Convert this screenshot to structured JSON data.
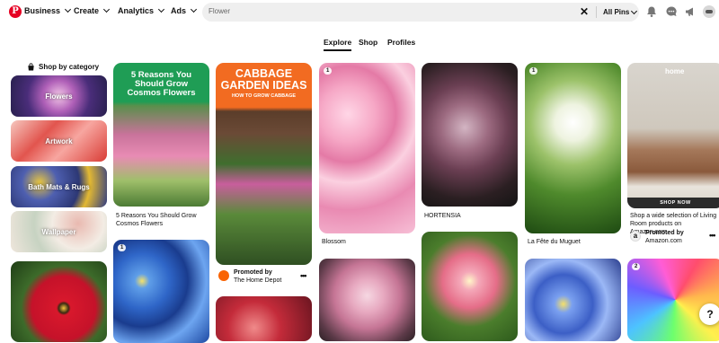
{
  "header": {
    "logo": "P",
    "nav": [
      "Business",
      "Create",
      "Analytics",
      "Ads"
    ],
    "search_value": "Flower",
    "search_clear": "✕",
    "filter_label": "All Pins",
    "icons": [
      "bell-icon",
      "messages-icon",
      "megaphone-icon",
      "account-avatar"
    ]
  },
  "tabs": [
    "Explore",
    "Shop",
    "Profiles"
  ],
  "categories": {
    "heading": "Shop by category",
    "items": [
      "Flowers",
      "Artwork",
      "Bath Mats & Rugs",
      "Wallpaper"
    ]
  },
  "pins": {
    "cosmos": {
      "title_line1": "5 Reasons You",
      "title_line2": "Should Grow",
      "title_line3": "Cosmos Flowers",
      "caption_line1": "5 Reasons You Should Grow",
      "caption_line2": "Cosmos Flowers"
    },
    "forgetmenot": {
      "badge": "1"
    },
    "cabbage": {
      "title_line1": "CABBAGE",
      "title_line2": "GARDEN IDEAS",
      "subtitle": "HOW TO GROW CABBAGE",
      "promoted_label": "Promoted by",
      "advertiser": "The Home Depot"
    },
    "blossom": {
      "badge": "1",
      "caption": "Blossom"
    },
    "hortensia": {
      "caption": "HORTENSIA"
    },
    "muguet": {
      "badge": "1",
      "caption": "La Fête du Muguet"
    },
    "amazon": {
      "brand": "home",
      "cta": "SHOP NOW",
      "caption_line1": "Shop a wide selection of Living",
      "caption_line2": "Room products on Amazon.com.",
      "promoted_label": "Promoted by",
      "advertiser": "Amazon.com"
    },
    "rainbow": {
      "badge": "2"
    }
  },
  "more_menu": "•••",
  "help": "?",
  "colors": {
    "brand": "#e60023",
    "search_bg": "#efefef",
    "cosmos_banner": "#1f9d55",
    "cabbage_banner": "#f26b21"
  }
}
